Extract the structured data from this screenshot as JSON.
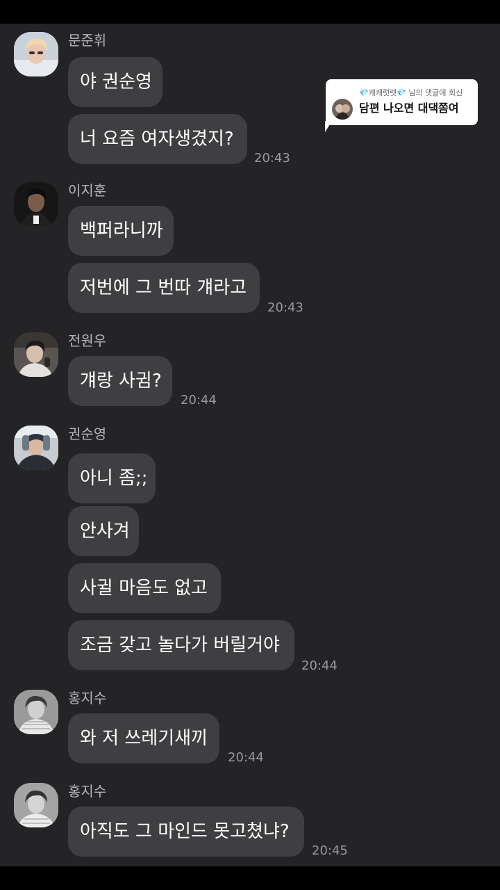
{
  "colors": {
    "background": "#242426",
    "bubble": "#3f3f42",
    "text": "#ffffff",
    "sender": "#b6b6b9",
    "time": "#9a9a9d",
    "reply_card": "#ffffff"
  },
  "reply_card": {
    "gem_left": "💎",
    "username": "캐캐럿렛",
    "gem_right": "💎",
    "suffix": " 님의 댓글에 회신",
    "comment": "담편 나오면 대댁쫌여"
  },
  "groups": [
    {
      "sender": "문준휘",
      "avatar_icon": "profile-photo",
      "messages": [
        "야 권순영",
        "너 요즘 여자생겼지?"
      ],
      "time": "20:43"
    },
    {
      "sender": "이지훈",
      "avatar_icon": "profile-photo",
      "messages": [
        "백퍼라니까",
        "저번에 그 번따 걔라고"
      ],
      "time": "20:43"
    },
    {
      "sender": "전원우",
      "avatar_icon": "profile-photo",
      "messages": [
        "걔랑 사귐?"
      ],
      "time": "20:44"
    },
    {
      "sender": "권순영",
      "avatar_icon": "profile-photo",
      "messages": [
        "아니 좀;;",
        "안사겨",
        "사귈 마음도 없고",
        "조금 갖고 놀다가 버릴거야"
      ],
      "time": "20:44"
    },
    {
      "sender": "홍지수",
      "avatar_icon": "profile-photo",
      "messages": [
        "와 저 쓰레기새끼"
      ],
      "time": "20:44"
    },
    {
      "sender": "홍지수",
      "avatar_icon": "profile-photo",
      "messages": [
        "아직도 그 마인드 못고쳤냐?"
      ],
      "time": "20:45"
    }
  ]
}
